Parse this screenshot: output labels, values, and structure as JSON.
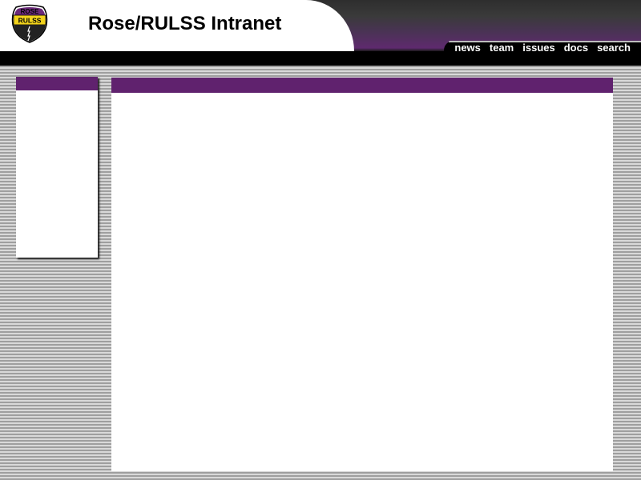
{
  "header": {
    "title": "Rose/RULSS Intranet",
    "logo": {
      "top_text": "ROSE",
      "band_text": "RULSS"
    }
  },
  "nav": {
    "items": [
      {
        "label": "news"
      },
      {
        "label": "team"
      },
      {
        "label": "issues"
      },
      {
        "label": "docs"
      },
      {
        "label": "search"
      }
    ]
  },
  "colors": {
    "accent_purple": "#60226e",
    "header_dark": "#2e2e2e",
    "logo_yellow": "#f2d31c"
  },
  "icons": {
    "logo": "highway-shield-logo"
  }
}
